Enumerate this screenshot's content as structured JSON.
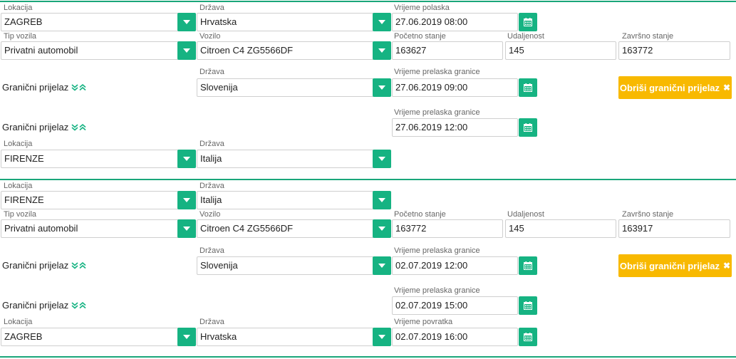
{
  "labels": {
    "lokacija": "Lokacija",
    "drzava": "Država",
    "vrijeme_polaska": "Vrijeme polaska",
    "tip_vozila": "Tip vozila",
    "vozilo": "Vozilo",
    "pocetno_stanje": "Početno stanje",
    "udaljenost": "Udaljenost",
    "zavrsno_stanje": "Završno stanje",
    "vrijeme_prelaska": "Vrijeme prelaska granice",
    "vrijeme_povratka": "Vrijeme povratka",
    "granicni_prijelaz": "Granični prijelaz",
    "obrisi": "Obriši granični prijelaz"
  },
  "icons": {
    "dropdown": "triangle-down-icon",
    "calendar": "calendar-icon",
    "expand": "chevron-double-down-icon",
    "collapse": "chevron-double-up-icon",
    "delete": "close-icon"
  },
  "colors": {
    "accent": "#16b382",
    "warning": "#f8b900",
    "separator": "#1aa67a"
  },
  "trip1": {
    "start_location": "ZAGREB",
    "start_country": "Hrvatska",
    "departure": "27.06.2019 08:00",
    "vehicle_type": "Privatni automobil",
    "vehicle": "Citroen C4 ZG5566DF",
    "start_odometer": "163627",
    "distance": "145",
    "end_odometer": "163772",
    "crossing1_country": "Slovenija",
    "crossing1_time": "27.06.2019 09:00",
    "crossing2_time": "27.06.2019 12:00",
    "end_location": "FIRENZE",
    "end_country": "Italija"
  },
  "trip2": {
    "start_location": "FIRENZE",
    "start_country": "Italija",
    "vehicle_type": "Privatni automobil",
    "vehicle": "Citroen C4 ZG5566DF",
    "start_odometer": "163772",
    "distance": "145",
    "end_odometer": "163917",
    "crossing1_country": "Slovenija",
    "crossing1_time": "02.07.2019 12:00",
    "crossing2_time": "02.07.2019 15:00",
    "end_location": "ZAGREB",
    "end_country": "Hrvatska",
    "return_time": "02.07.2019 16:00"
  }
}
